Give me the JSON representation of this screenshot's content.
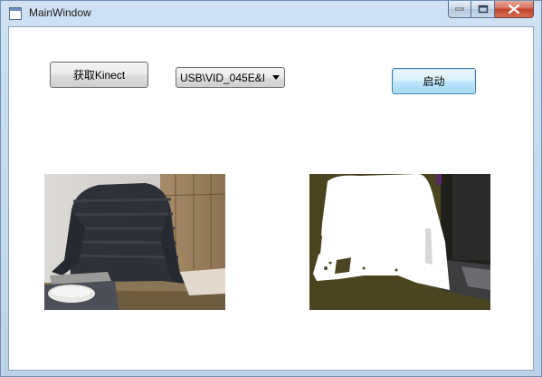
{
  "window": {
    "title": "MainWindow",
    "icon": "app-window-icon",
    "controls": [
      "minimize-icon",
      "maximize-icon",
      "close-icon"
    ]
  },
  "toolbar": {
    "get_kinect_label": "获取Kinect",
    "device_select_value": "USB\\VID_045E&I",
    "start_label": "启动"
  },
  "images": {
    "color_view": "kinect-color-camera-image",
    "depth_view": "kinect-depth-image"
  },
  "colors": {
    "depth_foreground": "#ffffff",
    "depth_background": "#4a4520",
    "start_accent": "#3c7fb1"
  }
}
